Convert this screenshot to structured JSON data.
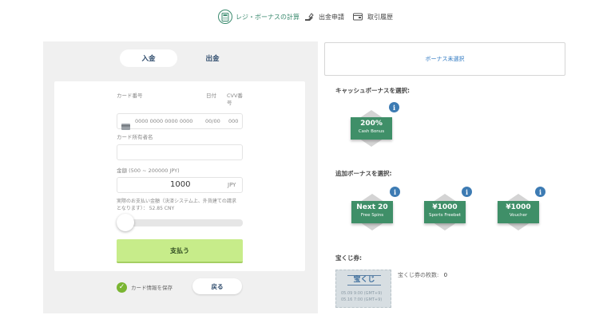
{
  "nav": {
    "calc_label": "レジ・ボーナスの計算",
    "withdraw_label": "出金申請",
    "history_label": "取引履歴"
  },
  "tabs": {
    "deposit": "入金",
    "withdraw": "出金"
  },
  "form": {
    "card_number_label": "カード番号",
    "date_label": "日付",
    "cvv_label_1": "CVV番",
    "cvv_label_2": "号",
    "card_number_placeholder": "0000 0000 0000 0000",
    "date_placeholder": "00/00",
    "cvv_placeholder": "000",
    "holder_label": "カード所有者名",
    "holder_value": "",
    "amount_label": "金額 (500 ~ 200000 JPY)",
    "amount_value": "1000",
    "amount_currency": "JPY",
    "note_1": "実際のお支払い金額（決済システム上、外貨建ての請求",
    "note_2": "となります）： 52.85 CNY",
    "slider_fraction": 0,
    "pay_label": "支払う",
    "save_label": "カード情報を保存",
    "back_label": "戻る"
  },
  "right": {
    "no_bonus": "ボーナス未選択",
    "cash_heading": "キャッシュボーナスを選択:",
    "extra_heading": "追加ボーナスを選択:",
    "lottery_heading": "宝くじ券:",
    "info_glyph": "i",
    "cash_bonuses": [
      {
        "title": "200%",
        "sub": "Cash Bonus"
      }
    ],
    "extra_bonuses": [
      {
        "title": "Next 20",
        "sub": "Free Spins"
      },
      {
        "title": "¥1000",
        "sub": "Sports Freebet"
      },
      {
        "title": "¥1000",
        "sub": "Voucher"
      }
    ],
    "ticket": {
      "title": "宝くじ",
      "date_1": "05.09 9:00 (GMT+9)",
      "date_2": "05.16 7:00 (GMT+9)"
    },
    "lottery_count_label": "宝くじ券の枚数:",
    "lottery_count": "0"
  },
  "colors": {
    "accent_green": "#3f8f68",
    "pay_button": "#c7ec8a",
    "link_blue": "#2f79c2",
    "info_blue": "#3d7bb3"
  },
  "icons": [
    "calculator-icon",
    "hand-coin-icon",
    "wallet-icon",
    "credit-card-icon",
    "check-icon",
    "info-icon"
  ]
}
